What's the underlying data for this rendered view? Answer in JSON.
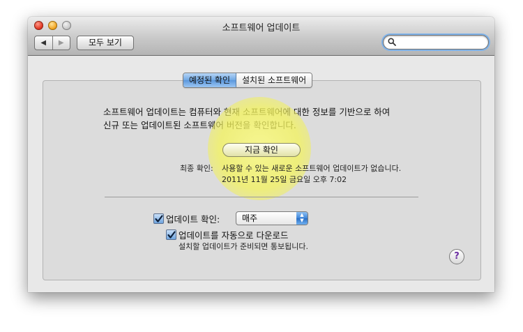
{
  "window": {
    "title": "소프트웨어 업데이트"
  },
  "toolbar": {
    "back_glyph": "◀",
    "forward_glyph": "▶",
    "show_all_label": "모두 보기",
    "search_placeholder": ""
  },
  "tabs": [
    {
      "label": "예정된 확인",
      "selected": true
    },
    {
      "label": "설치된 소프트웨어",
      "selected": false
    }
  ],
  "main": {
    "description_line1": "소프트웨어 업데이트는 컴퓨터와 현재 소프트웨어에 대한 정보를 기반으로 하여",
    "description_line2": "신규 또는 업데이트된 소프트웨어 버전을 확인합니다.",
    "check_now_label": "지금 확인",
    "last_check_label": "최종 확인:",
    "last_check_message": "사용할 수 있는 새로운 소프트웨어 업데이트가 없습니다.",
    "last_check_date": "2011년 11월 25일 금요일 오후 7:02"
  },
  "settings": {
    "check_updates_label": "업데이트 확인:",
    "check_updates_checked": true,
    "frequency_value": "매주",
    "auto_download_label": "업데이트를 자동으로 다운로드",
    "auto_download_checked": true,
    "auto_download_hint": "설치할 업데이트가 준비되면 통보됩니다."
  },
  "help": {
    "glyph": "?"
  },
  "icons": {
    "search": "magnifier-icon",
    "help": "question-icon",
    "checkbox": "checkmark-icon"
  },
  "colors": {
    "accent_blue": "#5b97dc",
    "highlight_yellow": "#f4f45a",
    "window_bg": "#e8e8e8"
  }
}
